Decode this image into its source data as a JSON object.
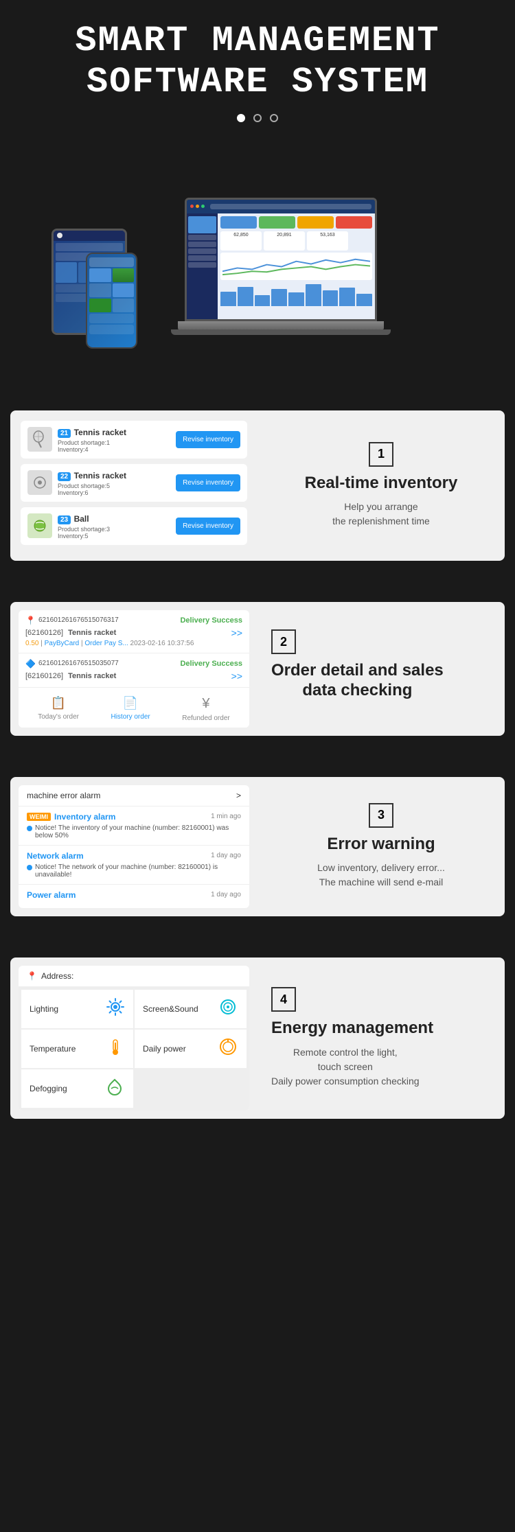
{
  "hero": {
    "title_line1": "Smart Management",
    "title_line2": "Software System",
    "dots": [
      {
        "active": true
      },
      {
        "active": false
      },
      {
        "active": false
      }
    ]
  },
  "section1": {
    "number": "1",
    "title": "Real-time inventory",
    "desc_line1": "Help you arrange",
    "desc_line2": "the replenishment time",
    "items": [
      {
        "num": "21",
        "name": "Tennis racket",
        "shortage_label": "Product shortage:",
        "shortage_val": "1",
        "inventory_label": "Inventory:",
        "inventory_val": "4",
        "btn": "Revise inventory"
      },
      {
        "num": "22",
        "name": "Tennis racket",
        "shortage_label": "Product shortage:",
        "shortage_val": "5",
        "inventory_label": "Inventory:",
        "inventory_val": "6",
        "btn": "Revise inventory"
      },
      {
        "num": "23",
        "name": "Ball",
        "shortage_label": "Product shortage:",
        "shortage_val": "3",
        "inventory_label": "Inventory:",
        "inventory_val": "5",
        "btn": "Revise inventory"
      }
    ]
  },
  "section2": {
    "number": "2",
    "title_line1": "Order detail and sales",
    "title_line2": "data checking",
    "orders": [
      {
        "id": "621601261676515076317",
        "status": "Delivery Success",
        "bracket_id": "[62160126]",
        "product": "Tennis racket",
        "amount": "0.50",
        "payment": "PayByCard",
        "pay_status": "Order Pay S...",
        "date": "2023-02-16 10:37:56"
      },
      {
        "id": "621601261676515035077",
        "status": "Delivery Success",
        "bracket_id": "[62160126]",
        "product": "Tennis racket"
      }
    ],
    "tabs": [
      {
        "label": "Today's order",
        "icon": "📋",
        "active": false
      },
      {
        "label": "History order",
        "icon": "📄",
        "active": true
      },
      {
        "label": "Refunded order",
        "icon": "¥",
        "active": false
      }
    ]
  },
  "section3": {
    "number": "3",
    "title": "Error warning",
    "desc_line1": "Low inventory, delivery error...",
    "desc_line2": "The machine will send e-mail",
    "header_text": "machine error alarm",
    "header_arrow": ">",
    "alarms": [
      {
        "brand": "WEIMI",
        "type": "Inventory alarm",
        "time": "1 min ago",
        "message": "Notice! The inventory of your machine (number: 82160001) was below 50%"
      },
      {
        "brand": "",
        "type": "Network alarm",
        "time": "1 day ago",
        "message": "Notice! The network of your machine (number: 82160001) is unavailable!"
      },
      {
        "brand": "",
        "type": "Power alarm",
        "time": "1 day ago",
        "message": ""
      }
    ]
  },
  "section4": {
    "number": "4",
    "title": "Energy management",
    "desc_line1": "Remote control the light,",
    "desc_line2": "touch screen",
    "desc_line3": "Daily power consumption checking",
    "address_label": "Address:",
    "controls": [
      {
        "label": "Lighting",
        "icon": "💧"
      },
      {
        "label": "Screen&Sound",
        "icon": "🔊"
      },
      {
        "label": "Temperature",
        "icon": "🌡️"
      },
      {
        "label": "Daily power",
        "icon": "⚙️"
      },
      {
        "label": "Defogging",
        "icon": "🌿"
      }
    ]
  }
}
